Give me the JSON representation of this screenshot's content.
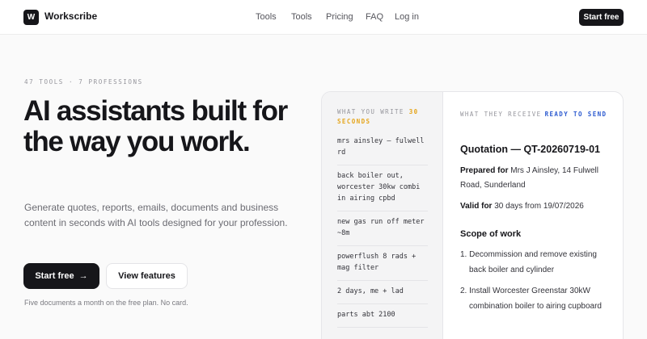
{
  "nav": {
    "logo_letter": "W",
    "brand": "Workscribe",
    "links": [
      "Tools",
      "Tools",
      "Pricing",
      "FAQ",
      "Log in"
    ],
    "cta": "Start free"
  },
  "hero": {
    "eyebrow": "47 TOOLS · 7 PROFESSIONS",
    "headline": "AI assistants built for the way you work.",
    "sub": "Generate quotes, reports, emails, documents and business content in seconds with AI tools designed for your profession.",
    "primary_cta": "Start free",
    "secondary_cta": "View features",
    "footnote": "Five documents a month on the free plan. No card."
  },
  "demo": {
    "input_label": "WHAT YOU WRITE",
    "input_time": "30 SECONDS",
    "notes": [
      "mrs ainsley — fulwell rd",
      "back boiler out, worcester 30kw combi in airing cpbd",
      "new gas run off meter ~8m",
      "powerflush 8 rads + mag filter",
      "2 days, me + lad",
      "parts abt 2100"
    ],
    "output_label": "WHAT THEY RECEIVE",
    "output_status": "READY TO SEND",
    "quote_title": "Quotation — QT-20260719-01",
    "prepared_label": "Prepared for",
    "prepared_value": "Mrs J Ainsley, 14 Fulwell Road, Sunderland",
    "valid_label": "Valid for",
    "valid_value": "30 days from 19/07/2026",
    "scope_title": "Scope of work",
    "scope_items": [
      "1. Decommission and remove existing back boiler and cylinder",
      "2. Install Worcester Greenstar 30kW combination boiler to airing cupboard"
    ]
  },
  "colors": {
    "ink": "#16161a",
    "accent_orange": "#e5a51b",
    "accent_blue": "#2d5bd0"
  },
  "icons": [
    "arrow-right-icon"
  ]
}
